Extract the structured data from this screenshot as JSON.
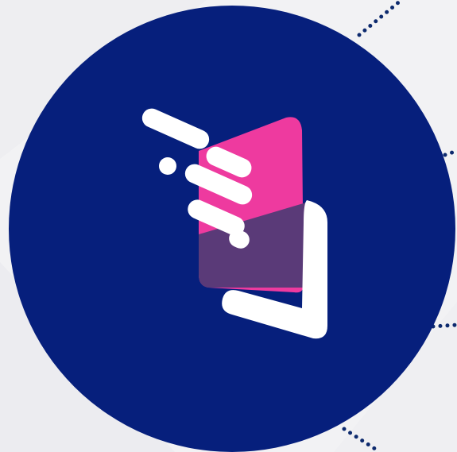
{
  "colors": {
    "background": "#f2f2f4",
    "circle": "#061f7c",
    "dots": "#0d2a6e",
    "logo_pink": "#ee3a9f",
    "logo_purple": "#5a3a78",
    "logo_white": "#ffffff"
  },
  "logo": {
    "icon": "fast-delivery-phone-logo-icon"
  }
}
